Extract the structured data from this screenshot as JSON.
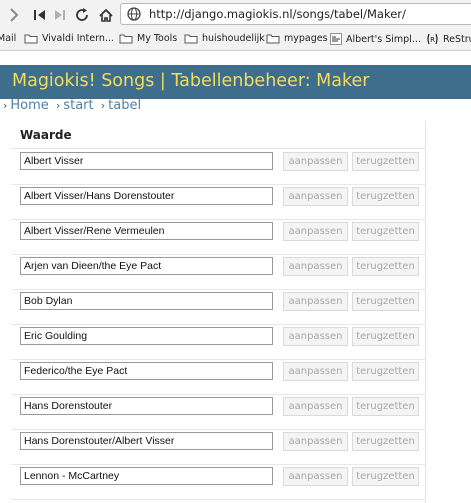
{
  "browser": {
    "url": "http://django.magiokis.nl/songs/tabel/Maker/",
    "bookmarks": [
      "Mail",
      "Vivaldi Intern...",
      "My Tools",
      "huishoudelijk",
      "mypages",
      "Albert's Simpl...",
      "ReStru"
    ]
  },
  "site": {
    "title": "Magiokis! Songs | Tabellenbeheer: Maker"
  },
  "breadcrumb": {
    "sep": "›",
    "items": [
      "Home",
      "start",
      "tabel"
    ]
  },
  "table": {
    "header": "Waarde",
    "edit_label": "aanpassen",
    "reset_label": "terugzetten",
    "rows": [
      "Albert Visser",
      "Albert Visser/Hans Dorenstouter",
      "Albert Visser/Rene Vermeulen",
      "Arjen van Dieen/the Eye Pact",
      "Bob Dylan",
      "Eric Goulding",
      "Federico/the Eye Pact",
      "Hans Dorenstouter",
      "Hans Dorenstouter/Albert Visser",
      "Lennon - McCartney"
    ]
  },
  "colors": {
    "header_bg": "#3d6f8c",
    "title_text": "#f2dc5d",
    "link": "#4f7fa8"
  }
}
